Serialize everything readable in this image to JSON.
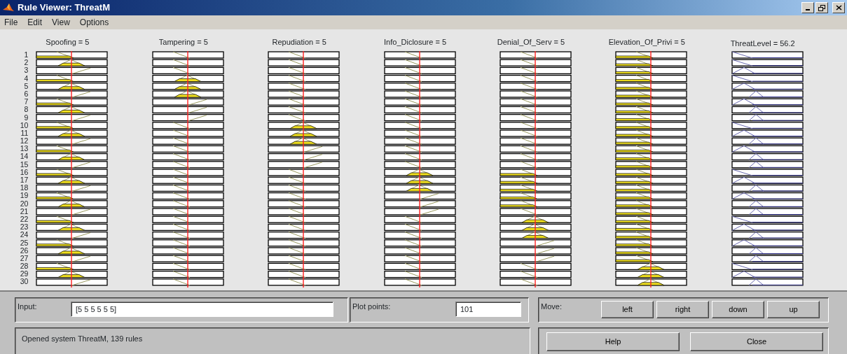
{
  "window": {
    "title": "Rule Viewer: ThreatM"
  },
  "menu": [
    "File",
    "Edit",
    "View",
    "Options"
  ],
  "plots": {
    "row_numbers": [
      "1",
      "2",
      "3",
      "4",
      "5",
      "6",
      "7",
      "8",
      "9",
      "10",
      "11",
      "12",
      "13",
      "14",
      "15",
      "16",
      "17",
      "18",
      "19",
      "20",
      "21",
      "22",
      "23",
      "24",
      "25",
      "26",
      "27",
      "28",
      "29",
      "30"
    ],
    "inputs": [
      {
        "label": "Spoofing = 5"
      },
      {
        "label": "Tampering = 5"
      },
      {
        "label": "Repudiation = 5"
      },
      {
        "label": "Info_Diclosure = 5"
      },
      {
        "label": "Denial_Of_Serv = 5"
      },
      {
        "label": "Elevation_Of_Privi = 5"
      }
    ],
    "output": {
      "label": "ThreatLevel = 56.2"
    }
  },
  "input_panel": {
    "label": "Input:",
    "value": "[5 5 5 5 5 5]"
  },
  "plot_points": {
    "label": "Plot points:",
    "value": "101"
  },
  "move": {
    "label": "Move:",
    "buttons": [
      "left",
      "right",
      "down",
      "up"
    ]
  },
  "status": "Opened system ThreatM, 139 rules",
  "buttons": [
    "Help",
    "Close"
  ]
}
